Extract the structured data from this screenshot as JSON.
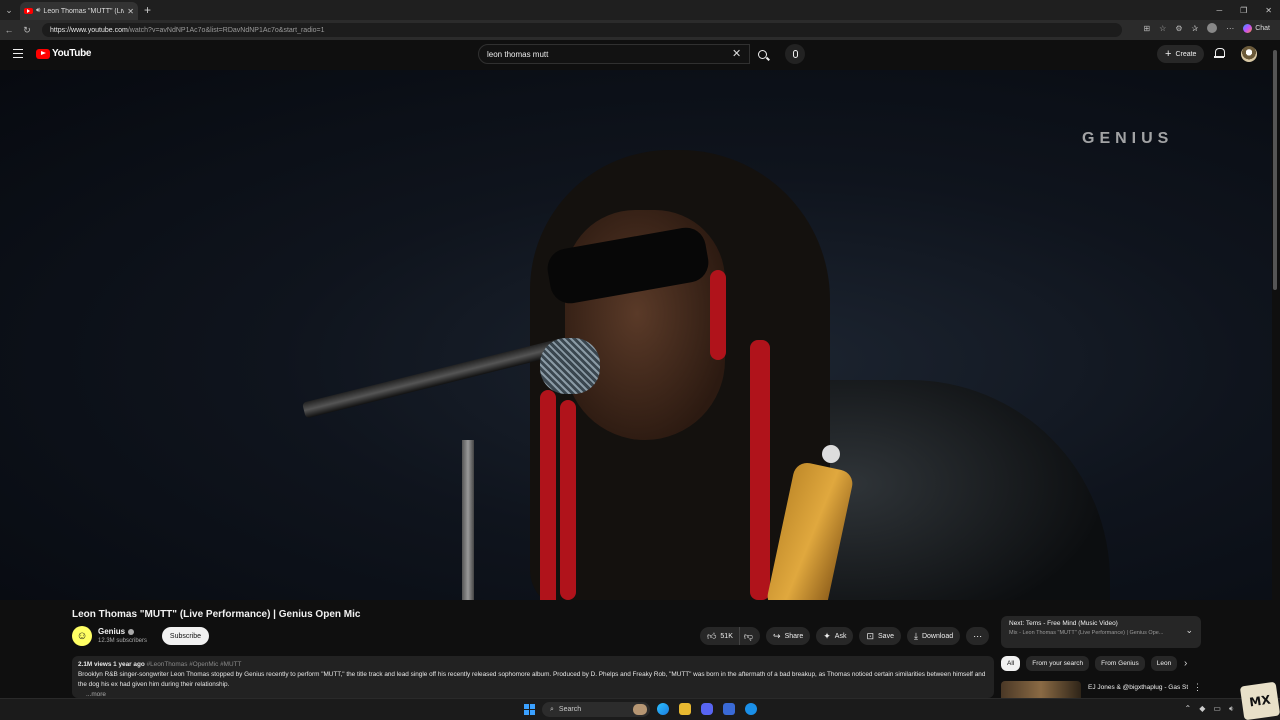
{
  "browser": {
    "tab_title": "Leon Thomas \"MUTT\" (Live P",
    "url_host": "https://www.youtube.com",
    "url_rest": "/watch?v=avNdNP1Ac7o&list=RDavNdNP1Ac7o&start_radio=1",
    "chat_label": "Chat"
  },
  "header": {
    "logo_text": "YouTube",
    "search_value": "leon thomas mutt",
    "create_label": "Create"
  },
  "video": {
    "watermark": "GENIUS",
    "title": "Leon Thomas \"MUTT\" (Live Performance) | Genius Open Mic"
  },
  "channel": {
    "name": "Genius",
    "subscribers": "12.3M subscribers",
    "subscribe_label": "Subscribe"
  },
  "actions": {
    "likes": "51K",
    "share": "Share",
    "ask": "Ask",
    "save": "Save",
    "download": "Download"
  },
  "description": {
    "meta": "2.1M views  1 year ago",
    "tags": "#LeonThomas #OpenMic #MUTT",
    "text": "Brooklyn R&B singer-songwriter Leon Thomas stopped by Genius recently to perform \"MUTT,\" the title track and lead single off his recently released sophomore album. Produced by D. Phelps and Freaky Rob, \"MUTT\" was born in the aftermath of a bad breakup, as Thomas noticed certain similarities between himself and the dog his ex had given him during their relationship.",
    "more": "...more"
  },
  "next": {
    "title": "Next: Tems - Free Mind (Music Video)",
    "subtitle": "Mix - Leon Thomas \"MUTT\" (Live Performance) | Genius Ope..."
  },
  "chips": [
    "All",
    "From your search",
    "From Genius",
    "Leon"
  ],
  "recommendation": {
    "title": "EJ Jones & @bigxthaplug - Gas Station Remix (Official Live"
  },
  "taskbar": {
    "search_label": "Search"
  }
}
